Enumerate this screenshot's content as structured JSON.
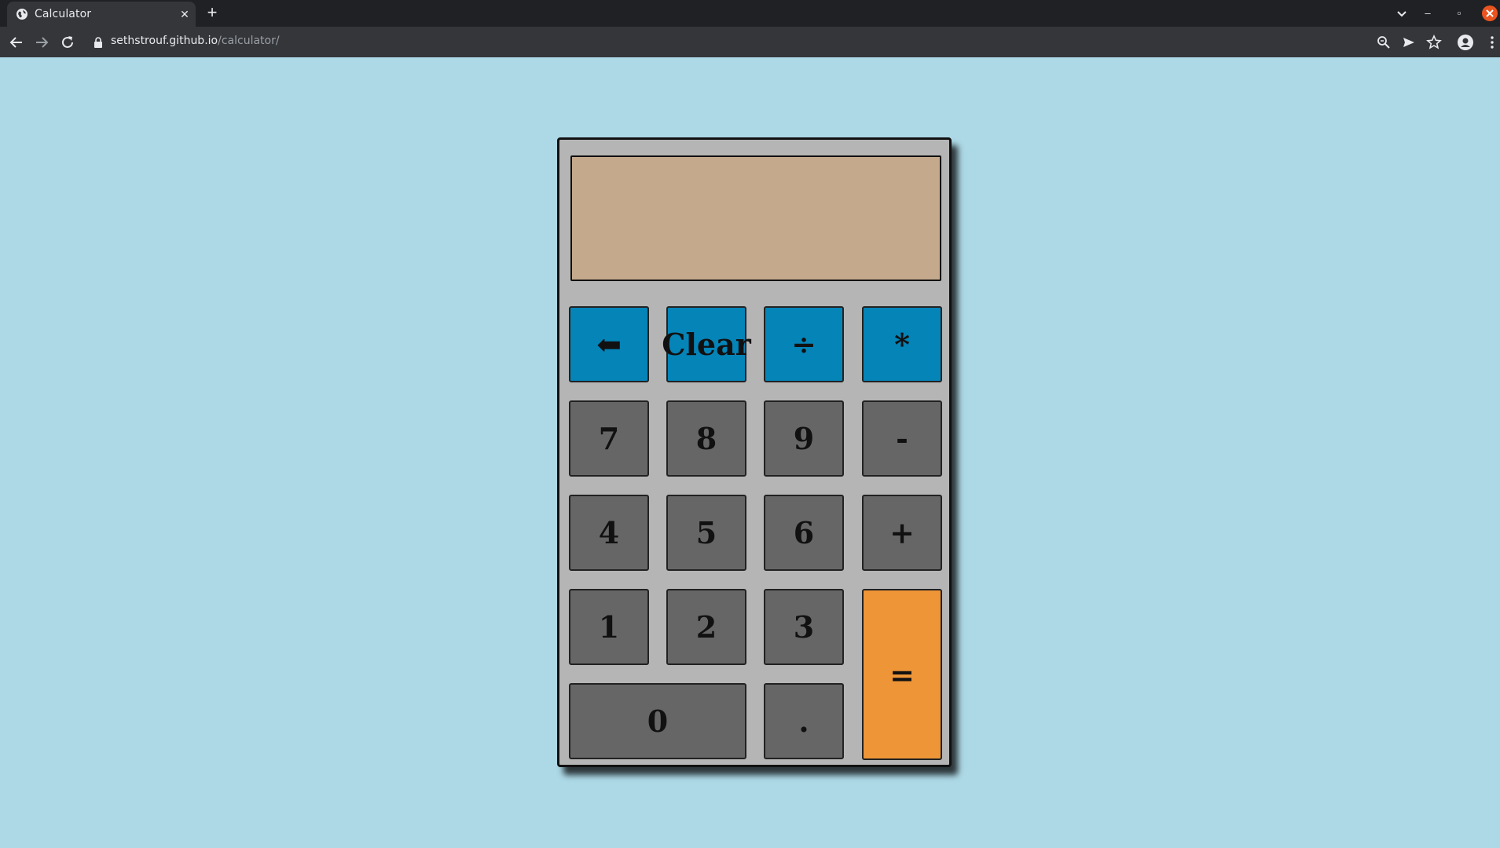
{
  "browser": {
    "tab_title": "Calculator",
    "tab_close": "✕",
    "new_tab": "+",
    "url_host": "sethstrouf.github.io",
    "url_path": "/calculator/",
    "minimize": "–",
    "maximize": "▫"
  },
  "calculator": {
    "display_value": "",
    "keys": {
      "backspace": "⬅",
      "clear": "Clear",
      "divide": "÷",
      "multiply": "*",
      "seven": "7",
      "eight": "8",
      "nine": "9",
      "subtract": "-",
      "four": "4",
      "five": "5",
      "six": "6",
      "add": "+",
      "one": "1",
      "two": "2",
      "three": "3",
      "equals": "=",
      "zero": "0",
      "decimal": "."
    },
    "colors": {
      "operator_blue": "#0584b8",
      "number_gray": "#666666",
      "equals_orange": "#ed9537",
      "display_tan": "#c4a98c",
      "body_gray": "#b5b5b5",
      "page_background": "#add8e6"
    }
  }
}
